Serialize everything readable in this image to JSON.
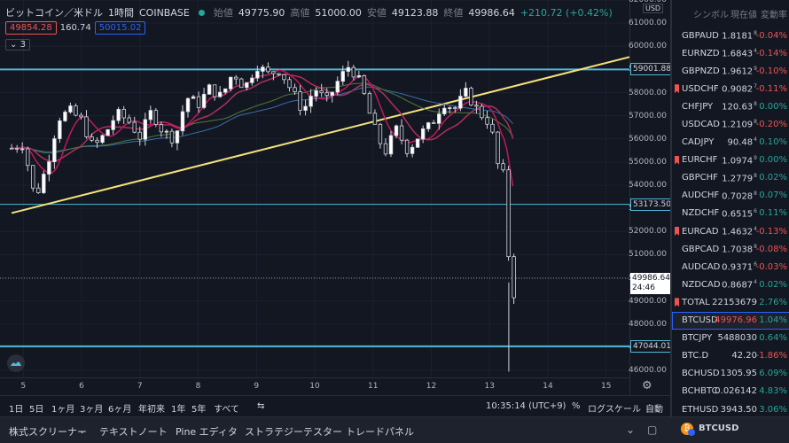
{
  "chart": {
    "title": "ビットコイン／米ドル",
    "interval": "1時間",
    "exchange": "COINBASE",
    "ohlc": [
      {
        "k": "始値",
        "v": "49775.90"
      },
      {
        "k": "高値",
        "v": "51000.00"
      },
      {
        "k": "安値",
        "v": "49123.88"
      },
      {
        "k": "終値",
        "v": "49986.64"
      }
    ],
    "change": "+210.72 (+0.42%)",
    "sell_price": "49854.28",
    "spread": "160.74",
    "buy_price": "50015.02",
    "indicator_count": "3",
    "currency_badge": "USD",
    "colors": {
      "background": "#131722",
      "up": "#26a69a",
      "down": "#ef5350",
      "trendline": "#f5e27a",
      "hline": "#50b8d8",
      "accent": "#2962ff"
    }
  },
  "price_axis": {
    "ticks": [
      "62000.00",
      "61000.00",
      "60000.00",
      "59000.00",
      "58000.00",
      "57000.00",
      "56000.00",
      "55000.00",
      "54000.00",
      "53000.00",
      "52000.00",
      "51000.00",
      "50000.00",
      "49000.00",
      "48000.00",
      "47000.00",
      "46000.00"
    ],
    "hline_labels": [
      "59001.88",
      "53173.50",
      "47044.01"
    ],
    "current_price": "49986.64",
    "countdown": "24:46"
  },
  "time_axis": {
    "ticks": [
      "5",
      "6",
      "7",
      "8",
      "9",
      "10",
      "11",
      "12",
      "13",
      "14",
      "15"
    ]
  },
  "bottom_bar": {
    "ranges": [
      "1日",
      "5日",
      "1ヶ月",
      "3ヶ月",
      "6ヶ月",
      "年初来",
      "1年",
      "5年",
      "すべて"
    ],
    "clock": "10:35:14 (UTC+9)",
    "percent": "%",
    "log_scale": "ログスケール",
    "auto": "自動"
  },
  "footer": {
    "tabs": [
      "株式スクリーナー",
      "テキストノート",
      "Pine エディタ",
      "ストラテジーテスター",
      "トレードパネル"
    ]
  },
  "chart_data": {
    "type": "candlestick",
    "x_ticks": [
      "5",
      "6",
      "7",
      "8",
      "9",
      "10",
      "11",
      "12",
      "13",
      "14",
      "15"
    ],
    "ylim": [
      45700,
      62000
    ],
    "horizontal_lines": [
      59001.88,
      53173.5,
      47044.01
    ],
    "trendline": {
      "from": [
        4.8,
        52800
      ],
      "to": [
        15.5,
        59600
      ]
    },
    "series": [
      {
        "name": "price_path",
        "x": [
          4.8,
          5.0,
          5.2,
          5.4,
          5.6,
          5.8,
          6.0,
          6.2,
          6.4,
          6.6,
          6.8,
          7.0,
          7.2,
          7.4,
          7.6,
          7.8,
          8.0,
          8.2,
          8.4,
          8.6,
          8.8,
          9.0,
          9.2,
          9.4,
          9.6,
          9.8,
          10.0,
          10.2,
          10.4,
          10.6,
          10.8,
          11.0,
          11.2,
          11.4,
          11.6,
          11.8,
          12.0,
          12.2,
          12.4,
          12.6,
          12.8,
          13.0,
          13.1,
          13.2,
          13.25,
          13.3,
          13.35,
          13.4,
          13.45
        ],
        "values": [
          55600,
          55800,
          53400,
          54800,
          56900,
          57200,
          56800,
          55600,
          56200,
          57100,
          56800,
          56100,
          57200,
          56300,
          56000,
          57800,
          57500,
          58200,
          57800,
          58900,
          58200,
          59200,
          58800,
          59000,
          58100,
          57200,
          58200,
          57600,
          58500,
          59200,
          58300,
          56600,
          55400,
          56400,
          55500,
          56200,
          56600,
          57600,
          57300,
          58000,
          57200,
          56700,
          55600,
          53900,
          54700,
          52500,
          49500,
          49000,
          49986.64
        ]
      }
    ]
  },
  "watchlist": {
    "headers": {
      "symbol": "シンボル",
      "last": "現在値",
      "change": "変動率"
    },
    "rows": [
      {
        "symbol": "GBPAUD",
        "price": "1.8181",
        "sub": "8",
        "change": "-0.04%",
        "dir": "dn",
        "flag": false
      },
      {
        "symbol": "EURNZD",
        "price": "1.6843",
        "sub": "4",
        "change": "-0.14%",
        "dir": "dn",
        "flag": false
      },
      {
        "symbol": "GBPNZD",
        "price": "1.9612",
        "sub": "9",
        "change": "-0.10%",
        "dir": "dn",
        "flag": false
      },
      {
        "symbol": "USDCHF",
        "price": "0.9082",
        "sub": "7",
        "change": "-0.11%",
        "dir": "dn",
        "flag": true
      },
      {
        "symbol": "CHFJPY",
        "price": "120.63",
        "sub": "8",
        "change": "0.00%",
        "dir": "up",
        "flag": false
      },
      {
        "symbol": "USDCAD",
        "price": "1.2109",
        "sub": "8",
        "change": "-0.20%",
        "dir": "dn",
        "flag": false
      },
      {
        "symbol": "CADJPY",
        "price": "90.48",
        "sub": "4",
        "change": "0.10%",
        "dir": "up",
        "flag": false
      },
      {
        "symbol": "EURCHF",
        "price": "1.0974",
        "sub": "9",
        "change": "0.00%",
        "dir": "up",
        "flag": true
      },
      {
        "symbol": "GBPCHF",
        "price": "1.2779",
        "sub": "8",
        "change": "0.02%",
        "dir": "up",
        "flag": false
      },
      {
        "symbol": "AUDCHF",
        "price": "0.7028",
        "sub": "8",
        "change": "0.07%",
        "dir": "up",
        "flag": false
      },
      {
        "symbol": "NZDCHF",
        "price": "0.6515",
        "sub": "6",
        "change": "0.11%",
        "dir": "up",
        "flag": false
      },
      {
        "symbol": "EURCAD",
        "price": "1.4632",
        "sub": "4",
        "change": "-0.13%",
        "dir": "dn",
        "flag": true
      },
      {
        "symbol": "GBPCAD",
        "price": "1.7038",
        "sub": "8",
        "change": "-0.08%",
        "dir": "dn",
        "flag": false
      },
      {
        "symbol": "AUDCAD",
        "price": "0.9371",
        "sub": "6",
        "change": "-0.03%",
        "dir": "dn",
        "flag": false
      },
      {
        "symbol": "NZDCAD",
        "price": "0.8687",
        "sub": "4",
        "change": "0.02%",
        "dir": "up",
        "flag": false
      },
      {
        "symbol": "TOTAL",
        "price": "22153679",
        "sub": "",
        "change": "2.76%",
        "dir": "up",
        "flag": true
      },
      {
        "symbol": "BTCUSD",
        "price": "49976.96",
        "sub": "",
        "change": "1.04%",
        "dir": "up",
        "flag": false,
        "selected": true
      },
      {
        "symbol": "BTCJPY",
        "price": "5488030",
        "sub": "",
        "change": "0.64%",
        "dir": "up",
        "flag": false
      },
      {
        "symbol": "BTC.D",
        "price": "42.20",
        "sub": "",
        "change": "-1.86%",
        "dir": "dn",
        "flag": false
      },
      {
        "symbol": "BCHUSD",
        "price": "1305.95",
        "sub": "",
        "change": "6.09%",
        "dir": "up",
        "flag": false
      },
      {
        "symbol": "BCHBTC",
        "price": "0.026142",
        "sub": "",
        "change": "4.83%",
        "dir": "up",
        "flag": false
      },
      {
        "symbol": "ETHUSD",
        "price": "3943.50",
        "sub": "",
        "change": "3.06%",
        "dir": "up",
        "flag": false
      }
    ],
    "footer_symbol": "BTCUSD"
  }
}
